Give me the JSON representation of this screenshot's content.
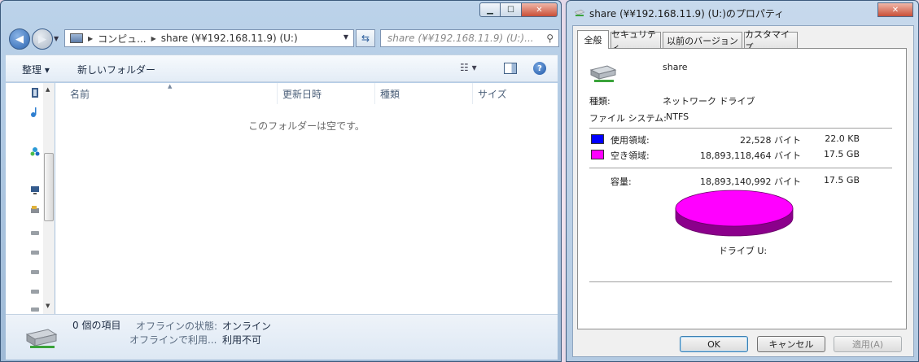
{
  "explorer": {
    "address": {
      "segments": [
        "コンピュ...",
        "share (¥¥192.168.11.9) (U:)"
      ]
    },
    "search": {
      "placeholder": "share (¥¥192.168.11.9) (U:)..."
    },
    "toolbar": {
      "organize_label": "整理 ▾",
      "new_folder_label": "新しいフォルダー"
    },
    "columns": [
      "名前",
      "更新日時",
      "種類",
      "サイズ"
    ],
    "empty_message": "このフォルダーは空です。",
    "details": {
      "item_count": "0 個の項目",
      "offline_state_label": "オフラインの状態:",
      "offline_state_value": "オンライン",
      "offline_use_label": "オフラインで利用...",
      "offline_use_value": "利用不可"
    }
  },
  "properties": {
    "title": "share (¥¥192.168.11.9) (U:)のプロパティ",
    "tabs": [
      "全般",
      "セキュリティ",
      "以前のバージョン",
      "カスタマイズ"
    ],
    "active_tab": "全般",
    "drive_name": "share",
    "type_label": "種類:",
    "type_value": "ネットワーク ドライブ",
    "fs_label": "ファイル システム:",
    "fs_value": "NTFS",
    "used": {
      "label": "使用領域:",
      "bytes": "22,528 バイト",
      "size": "22.0 KB",
      "color": "#0000ff"
    },
    "free": {
      "label": "空き領域:",
      "bytes": "18,893,118,464 バイト",
      "size": "17.5 GB",
      "color": "#ff00ff"
    },
    "capacity": {
      "label": "容量:",
      "bytes": "18,893,140,992 バイト",
      "size": "17.5 GB"
    },
    "drive_label": "ドライブ U:",
    "buttons": {
      "ok": "OK",
      "cancel": "キャンセル",
      "apply": "適用(A)"
    }
  }
}
